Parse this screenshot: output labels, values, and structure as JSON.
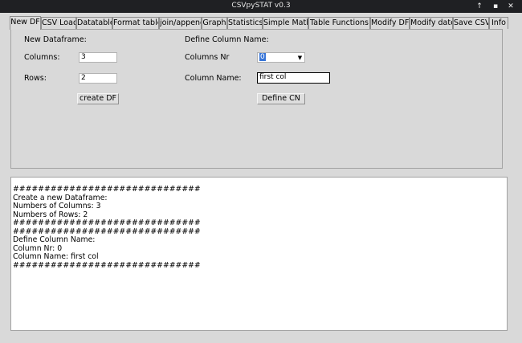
{
  "window": {
    "title": "CSVpySTAT v0.3",
    "buttons": [
      "↑",
      "▪",
      "✕"
    ]
  },
  "tabs": [
    {
      "label": "New DF",
      "active": true
    },
    {
      "label": "CSV Load"
    },
    {
      "label": "Datatable"
    },
    {
      "label": "Format table"
    },
    {
      "label": "join/append"
    },
    {
      "label": "Graph"
    },
    {
      "label": "Statistics"
    },
    {
      "label": "Simple Math"
    },
    {
      "label": "Table Functions"
    },
    {
      "label": "Modify DF"
    },
    {
      "label": "Modify date"
    },
    {
      "label": "Save CSV"
    },
    {
      "label": "Info"
    }
  ],
  "new_df": {
    "heading": "New Dataframe:",
    "columns_label": "Columns:",
    "columns_value": "3",
    "rows_label": "Rows:",
    "rows_value": "2",
    "create_button": "create DF"
  },
  "define_cn": {
    "heading": "Define Column Name:",
    "column_nr_label": "Columns Nr",
    "column_nr_value": "0",
    "column_name_label": "Column Name:",
    "column_name_value": "first col",
    "define_button": "Define CN"
  },
  "output": {
    "lines": [
      "##############################",
      "Create a new Dataframe:",
      "Numbers of Columns: 3",
      "Numbers of Rows: 2",
      "##############################",
      "##############################",
      "Define Column Name:",
      "Column Nr: 0",
      "Column Name: first col",
      "##############################"
    ]
  }
}
